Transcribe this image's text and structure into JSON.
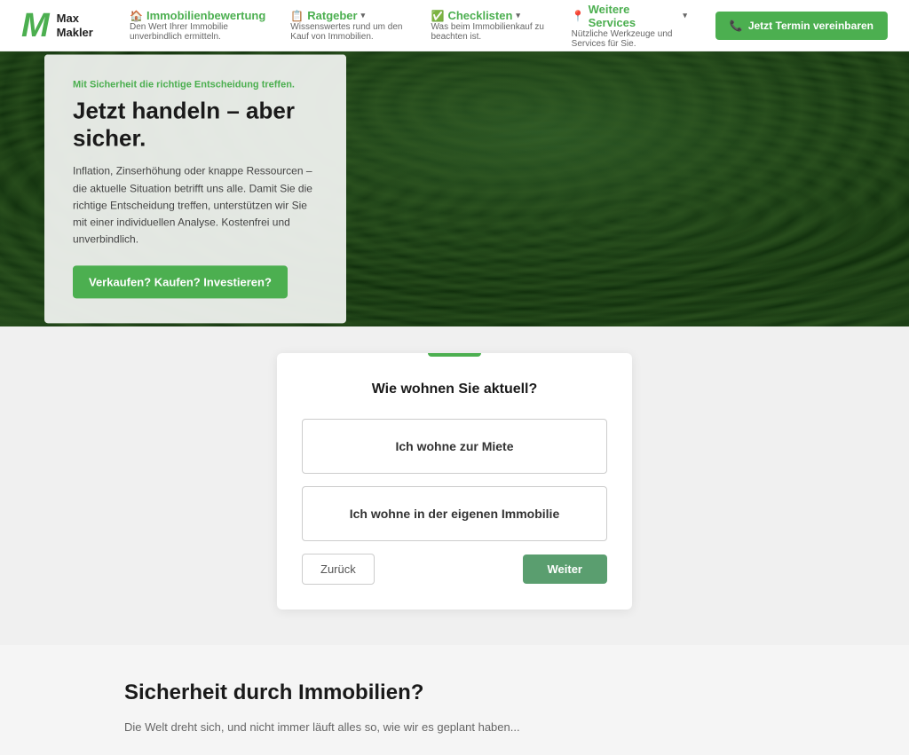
{
  "navbar": {
    "logo": {
      "letter": "M",
      "line1": "Max",
      "line2": "Makler"
    },
    "nav1": {
      "label": "Immobilienbewertung",
      "sub": "Den Wert Ihrer Immobilie unverbindlich ermitteln.",
      "icon": "🏠"
    },
    "nav2": {
      "label": "Ratgeber",
      "sub": "Wissenswertes rund um den Kauf von Immobilien.",
      "icon": "📋",
      "has_chevron": true
    },
    "nav3": {
      "label": "Checklisten",
      "sub": "Was beim Immobilienkauf zu beachten ist.",
      "icon": "✅",
      "has_chevron": true
    },
    "nav4": {
      "label": "Weitere Services",
      "sub": "Nützliche Werkzeuge und Services für Sie.",
      "icon": "📍",
      "has_chevron": true
    },
    "cta_label": "Jetzt Termin vereinbaren",
    "cta_icon": "📞"
  },
  "hero": {
    "tag": "Mit Sicherheit die richtige Entscheidung treffen.",
    "title": "Jetzt handeln – aber sicher.",
    "description": "Inflation, Zinserhöhung oder knappe Ressourcen – die aktuelle Situation betrifft uns alle. Damit Sie die richtige Entscheidung treffen, unterstützen wir Sie mit einer individuellen Analyse. Kostenfrei und unverbindlich.",
    "btn_label": "Verkaufen? Kaufen? Investieren?"
  },
  "quiz": {
    "question": "Wie wohnen Sie aktuell?",
    "option1": "Ich wohne zur Miete",
    "option2": "Ich wohne in der eigenen Immobilie",
    "back_label": "Zurück",
    "next_label": "Weiter"
  },
  "bottom": {
    "title": "Sicherheit durch Immobilien?",
    "text": "Die Welt dreht sich, und nicht immer läuft alles so, wie wir es geplant haben..."
  }
}
